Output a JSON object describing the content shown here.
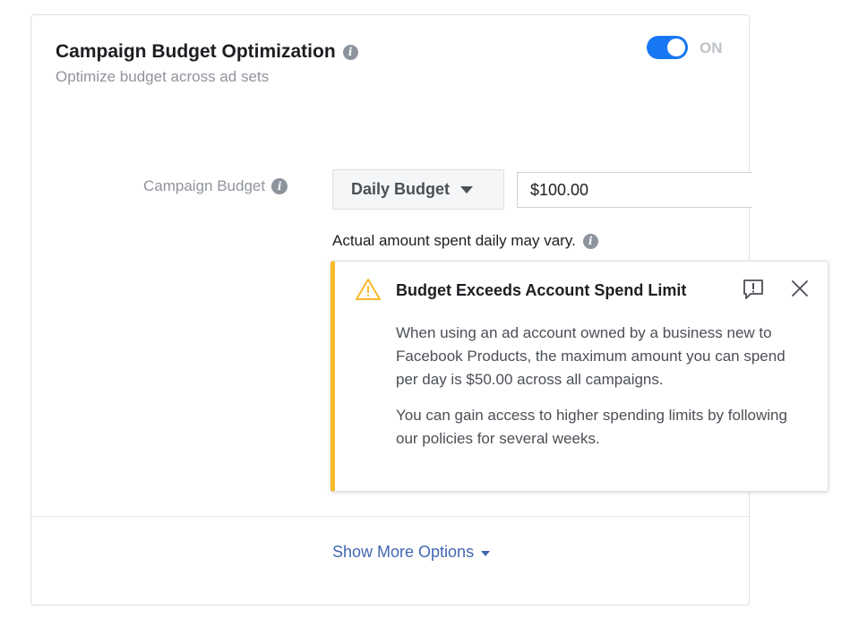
{
  "header": {
    "title": "Campaign Budget Optimization",
    "subtitle": "Optimize budget across ad sets",
    "toggle_state": "ON",
    "toggle_on": true,
    "accent_color": "#1877f2"
  },
  "budget": {
    "label": "Campaign Budget",
    "type_selected": "Daily Budget",
    "amount": "$100.00",
    "note": "Actual amount spent daily may vary."
  },
  "warning": {
    "title": "Budget Exceeds Account Spend Limit",
    "paragraphs": [
      "When using an ad account owned by a business new to Facebook Products, the maximum amount you can spend per day is $50.00 across all campaigns.",
      "You can gain access to higher spending limits by following our policies for several weeks."
    ],
    "accent_color": "#f7b928",
    "icons": [
      "warning-icon",
      "feedback-icon",
      "close-icon"
    ]
  },
  "footer": {
    "more_options": "Show More Options"
  }
}
